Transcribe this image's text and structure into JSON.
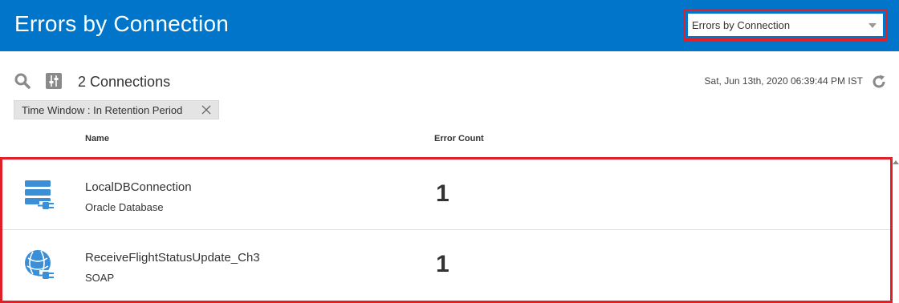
{
  "header": {
    "title": "Errors by Connection",
    "view_selector": {
      "selected": "Errors by Connection"
    }
  },
  "toolbar": {
    "connection_count": "2 Connections",
    "timestamp": "Sat, Jun 13th, 2020 06:39:44 PM IST",
    "filter_chip": "Time Window : In Retention Period"
  },
  "table": {
    "columns": {
      "name": "Name",
      "error_count": "Error Count"
    },
    "rows": [
      {
        "name": "LocalDBConnection",
        "type": "Oracle Database",
        "error_count": "1",
        "icon": "database-adapter-icon"
      },
      {
        "name": "ReceiveFlightStatusUpdate_Ch3",
        "type": "SOAP",
        "error_count": "1",
        "icon": "soap-adapter-icon"
      }
    ]
  },
  "colors": {
    "header_bg": "#0075c9",
    "highlight": "#e01f26",
    "icon_blue": "#3b8fd6"
  }
}
